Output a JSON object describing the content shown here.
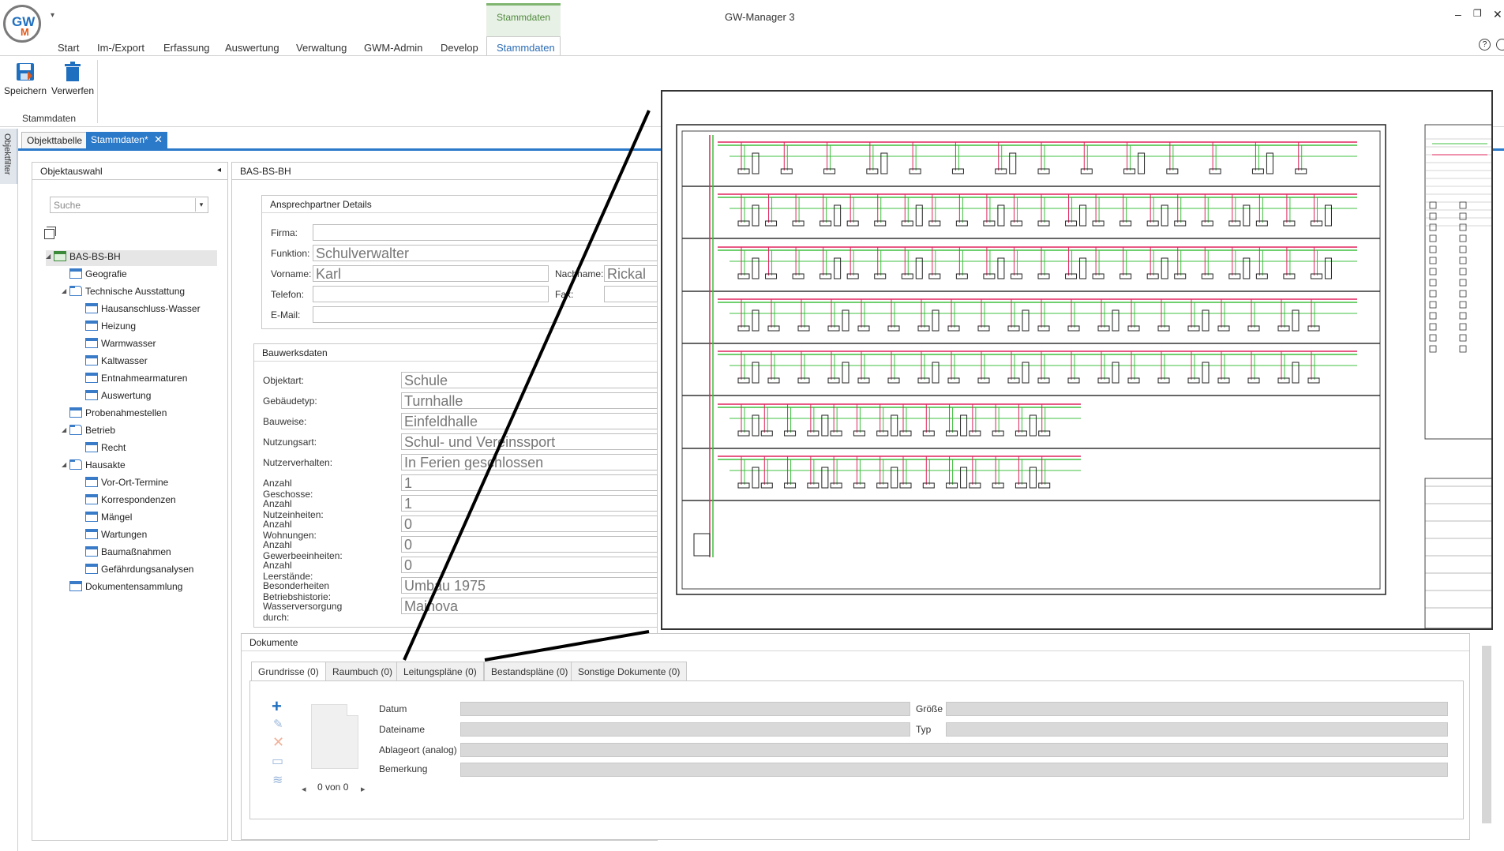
{
  "app": {
    "title": "GW-Manager 3",
    "logo_text_1": "GW",
    "logo_text_2": "M",
    "qat_glyph": "▾",
    "context_group": "Stammdaten"
  },
  "window_buttons": {
    "minimize": "–",
    "restore": "❐",
    "close": "✕"
  },
  "ribbon": {
    "tabs": [
      "Start",
      "Im-/Export",
      "Erfassung",
      "Auswertung",
      "Verwaltung",
      "GWM-Admin",
      "Develop",
      "Stammdaten"
    ],
    "buttons": {
      "save": "Speichern",
      "discard": "Verwerfen"
    },
    "group_label": "Stammdaten",
    "help": "?"
  },
  "side_filter": "Objektfilter",
  "doc_tabs": {
    "tab1": "Objekttabelle",
    "tab2": "Stammdaten*",
    "close": "✕"
  },
  "left_pane": {
    "title": "Objektauswahl",
    "collapse": "◂",
    "search_placeholder": "Suche",
    "tree": [
      {
        "label": "BAS-BS-BH",
        "toggle": "◢",
        "icon": "house"
      },
      {
        "label": "Geografie",
        "toggle": "",
        "icon": "doc"
      },
      {
        "label": "Technische Ausstattung",
        "toggle": "◢",
        "icon": "folder"
      },
      {
        "label": "Hausanschluss-Wasser",
        "toggle": "",
        "icon": "doc"
      },
      {
        "label": "Heizung",
        "toggle": "",
        "icon": "doc"
      },
      {
        "label": "Warmwasser",
        "toggle": "",
        "icon": "doc"
      },
      {
        "label": "Kaltwasser",
        "toggle": "",
        "icon": "doc"
      },
      {
        "label": "Entnahmearmaturen",
        "toggle": "",
        "icon": "doc"
      },
      {
        "label": "Auswertung",
        "toggle": "",
        "icon": "doc"
      },
      {
        "label": "Probenahmestellen",
        "toggle": "",
        "icon": "doc"
      },
      {
        "label": "Betrieb",
        "toggle": "◢",
        "icon": "folder"
      },
      {
        "label": "Recht",
        "toggle": "",
        "icon": "doc"
      },
      {
        "label": "Hausakte",
        "toggle": "◢",
        "icon": "folder"
      },
      {
        "label": "Vor-Ort-Termine",
        "toggle": "",
        "icon": "doc"
      },
      {
        "label": "Korrespondenzen",
        "toggle": "",
        "icon": "doc"
      },
      {
        "label": "Mängel",
        "toggle": "",
        "icon": "doc"
      },
      {
        "label": "Wartungen",
        "toggle": "",
        "icon": "doc"
      },
      {
        "label": "Baumaßnahmen",
        "toggle": "",
        "icon": "doc"
      },
      {
        "label": "Gefährdungsanalysen",
        "toggle": "",
        "icon": "doc"
      },
      {
        "label": "Dokumentensammlung",
        "toggle": "",
        "icon": "doc"
      }
    ]
  },
  "mid_pane": {
    "title": "BAS-BS-BH",
    "contact": {
      "title": "Ansprechpartner Details",
      "firma_label": "Firma:",
      "firma": "",
      "funktion_label": "Funktion:",
      "funktion": "Schulverwalter",
      "vorname_label": "Vorname:",
      "vorname": "Karl",
      "nachname_label": "Nachname:",
      "nachname": "Rickal",
      "telefon_label": "Telefon:",
      "telefon": "",
      "fax_label": "Fax:",
      "fax": "",
      "email_label": "E-Mail:",
      "email": ""
    },
    "building": {
      "title": "Bauwerksdaten",
      "rows": [
        {
          "label": "Objektart:",
          "value": "Schule"
        },
        {
          "label": "Gebäudetyp:",
          "value": "Turnhalle"
        },
        {
          "label": "Bauweise:",
          "value": "Einfeldhalle"
        },
        {
          "label": "Nutzungsart:",
          "value": "Schul- und Vereinssport"
        },
        {
          "label": "Nutzerverhalten:",
          "value": "In Ferien geschlossen"
        },
        {
          "label": "Anzahl Geschosse:",
          "value": "1"
        },
        {
          "label": "Anzahl Nutzeinheiten:",
          "value": "1"
        },
        {
          "label": "Anzahl Wohnungen:",
          "value": "0"
        },
        {
          "label": "Anzahl Gewerbeeinheiten:",
          "value": "0"
        },
        {
          "label": "Anzahl Leerstände:",
          "value": "0"
        },
        {
          "label": "Besonderheiten Betriebshistorie:",
          "value": "Umbau 1975"
        },
        {
          "label": "Wasserversorgung durch:",
          "value": "Mainova"
        }
      ]
    }
  },
  "documents": {
    "title": "Dokumente",
    "tabs": [
      "Grundrisse (0)",
      "Raumbuch (0)",
      "Leitungspläne (0)",
      "Bestandspläne (0)",
      "Sonstige Dokumente (0)"
    ],
    "fields": {
      "datum": "Datum",
      "groesse": "Größe",
      "dateiname": "Dateiname",
      "typ": "Typ",
      "ablageort": "Ablageort (analog)",
      "bemerkung": "Bemerkung"
    },
    "pager": "0 von 0",
    "icons": {
      "add": "+",
      "edit": "✎",
      "delete": "✕",
      "open": "▭",
      "db": "≋"
    },
    "pager_prev": "◂",
    "pager_next": "▸"
  },
  "colors": {
    "accent": "#2b79c9",
    "context_green": "#7fb56f",
    "pipe_red": "#e0245e",
    "pipe_green": "#3fbf3f"
  }
}
